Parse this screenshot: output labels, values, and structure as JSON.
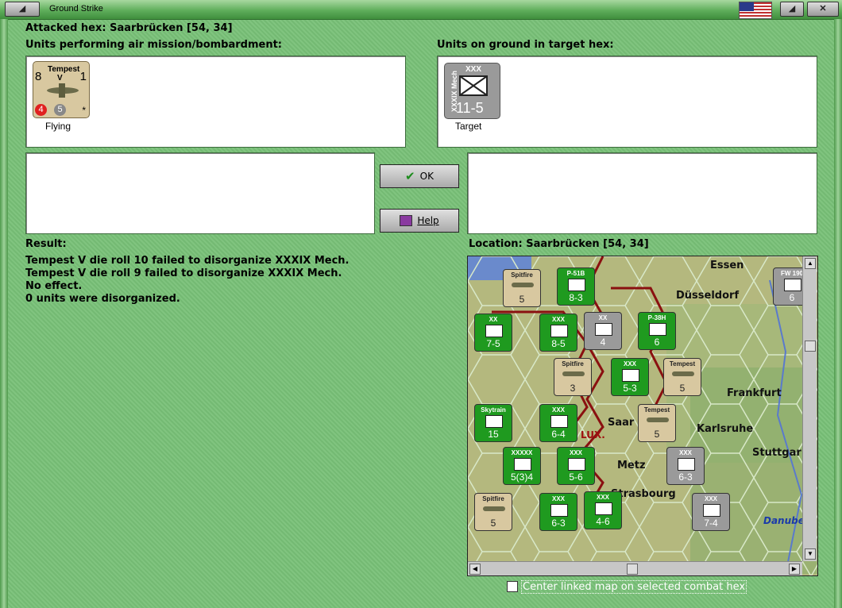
{
  "window": {
    "title": "Ground Strike"
  },
  "header": {
    "attacked_hex": "Attacked hex: Saarbrücken  [54, 34]"
  },
  "air_panel": {
    "label": "Units performing air mission/bombardment:",
    "unit": {
      "name": "Tempest",
      "variant": "V",
      "top_left": "8",
      "top_right": "1",
      "attack": "4",
      "defense": "5",
      "star": "*",
      "status": "Flying"
    }
  },
  "ground_panel": {
    "label": "Units on ground in target hex:",
    "unit": {
      "size": "XXX",
      "side_text": "XXXIX Mech",
      "strength": "11-5",
      "status": "Target"
    }
  },
  "buttons": {
    "ok": "OK",
    "help": "Help"
  },
  "result": {
    "label": "Result:",
    "lines": [
      "Tempest V die roll 10 failed to disorganize XXXIX Mech.",
      "Tempest V die roll 9 failed to disorganize XXXIX Mech.",
      "No effect.",
      "0 units were disorganized."
    ]
  },
  "location": {
    "label": "Location:  Saarbrücken  [54, 34]"
  },
  "map": {
    "cities": [
      "Essen",
      "Düsseldorf",
      "Frankfurt",
      "Karlsruhe",
      "Stuttgar",
      "Metz",
      "Strasbourg",
      "Saar",
      "LUX.",
      "Danube"
    ],
    "counters": [
      {
        "label": "Spitfire",
        "value": "5"
      },
      {
        "label": "P-51B",
        "value": "8-3"
      },
      {
        "label": "XX",
        "value": "7-5"
      },
      {
        "label": "XXX",
        "value": "8-5"
      },
      {
        "label": "XX",
        "value": "4"
      },
      {
        "label": "P-38H",
        "value": "6"
      },
      {
        "label": "FW 190",
        "value": "6"
      },
      {
        "label": "Spitfire",
        "value": "3"
      },
      {
        "label": "XXX",
        "value": "5-3"
      },
      {
        "label": "Tempest",
        "value": "5"
      },
      {
        "label": "Skytrain",
        "value": "15"
      },
      {
        "label": "XXX",
        "value": "6-4"
      },
      {
        "label": "Tempest",
        "value": "5"
      },
      {
        "label": "XXXXX",
        "value": "5(3)4"
      },
      {
        "label": "XXX",
        "value": "5-6"
      },
      {
        "label": "XXX",
        "value": "6-3"
      },
      {
        "label": "Spitfire",
        "value": "5"
      },
      {
        "label": "XXX",
        "value": "6-3"
      },
      {
        "label": "XXX",
        "value": "4-6"
      },
      {
        "label": "XXX",
        "value": "7-4"
      }
    ]
  },
  "checkbox": {
    "label": "Center linked map on selected combat hex"
  },
  "colors": {
    "background": "#79c178",
    "allied_green": "#1f9a1f",
    "axis_gray": "#9a9a9a",
    "counter_tan": "#d8c8a0"
  }
}
